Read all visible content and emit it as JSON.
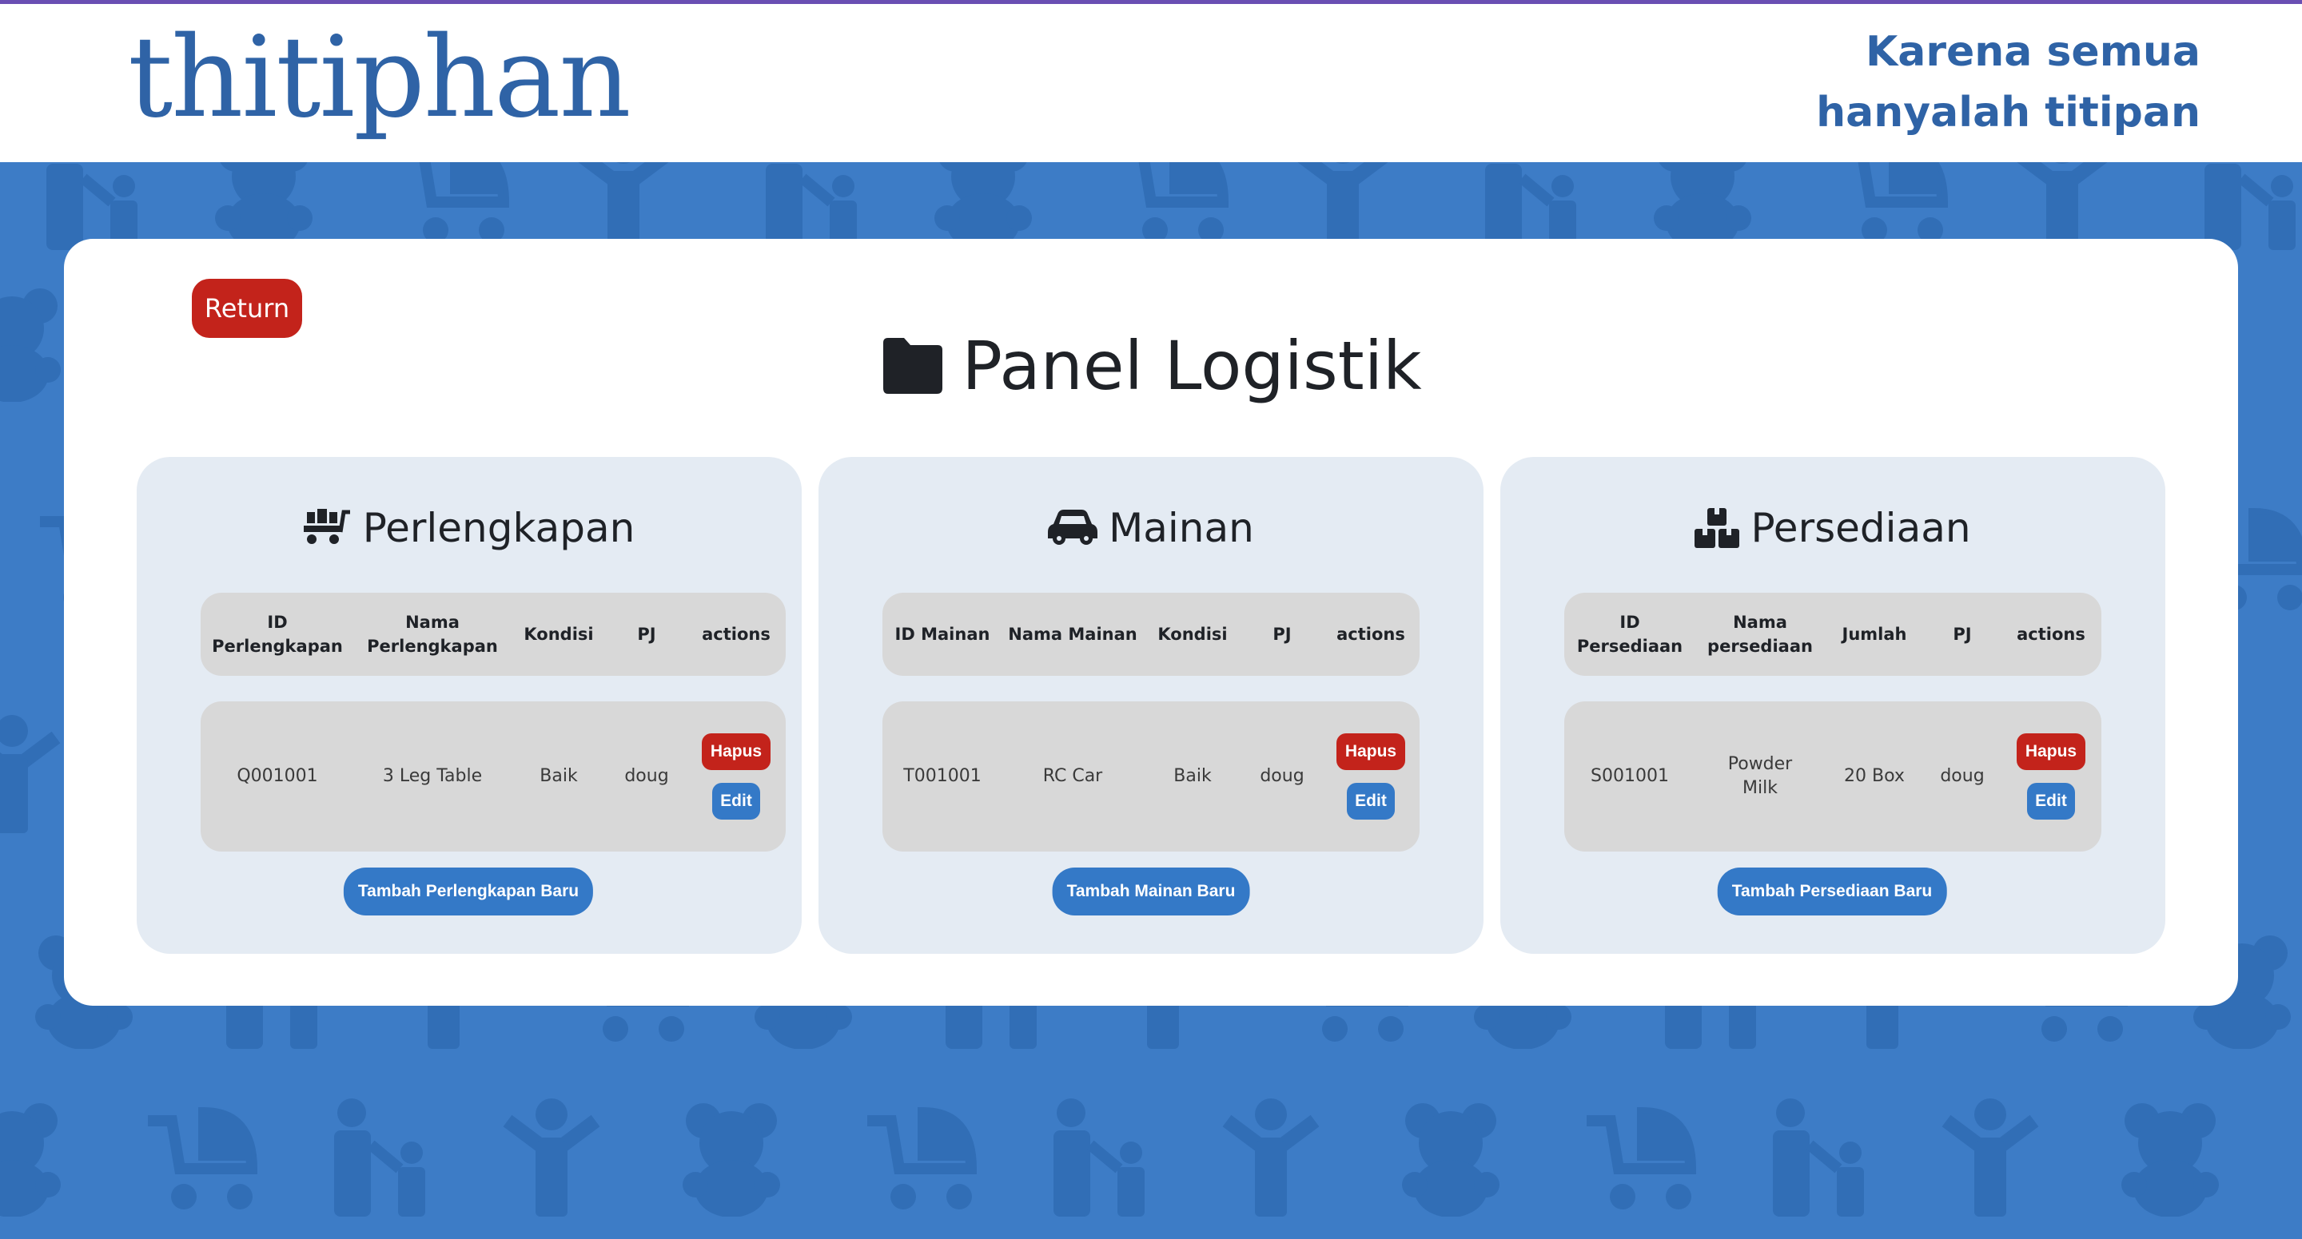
{
  "header": {
    "logo_text": "thitiphan",
    "tagline_line1": "Karena semua",
    "tagline_line2": "hanyalah titipan"
  },
  "main": {
    "return_label": "Return",
    "page_title": "Panel Logistik",
    "title_icon": "folder-icon"
  },
  "colors": {
    "accent_blue": "#3d7cc6",
    "brand_blue": "#2f63a6",
    "danger_red": "#c3231b",
    "button_blue": "#3479c7",
    "card_bg": "#e4ebf3",
    "table_bg": "#d8d8d8"
  },
  "cards": [
    {
      "title": "Perlengkapan",
      "icon": "dolly-cart-icon",
      "headers": [
        "ID Perlengkapan",
        "Nama Perlengkapan",
        "Kondisi",
        "PJ",
        "actions"
      ],
      "rows": [
        {
          "id": "Q001001",
          "name": "3 Leg Table",
          "col3": "Baik",
          "pj": "doug"
        }
      ],
      "delete_label": "Hapus",
      "edit_label": "Edit",
      "add_label": "Tambah Perlengkapan Baru"
    },
    {
      "title": "Mainan",
      "icon": "car-icon",
      "headers": [
        "ID Mainan",
        "Nama Mainan",
        "Kondisi",
        "PJ",
        "actions"
      ],
      "rows": [
        {
          "id": "T001001",
          "name": "RC Car",
          "col3": "Baik",
          "pj": "doug"
        }
      ],
      "delete_label": "Hapus",
      "edit_label": "Edit",
      "add_label": "Tambah Mainan Baru"
    },
    {
      "title": "Persediaan",
      "icon": "boxes-icon",
      "headers": [
        "ID Persediaan",
        "Nama persediaan",
        "Jumlah",
        "PJ",
        "actions"
      ],
      "rows": [
        {
          "id": "S001001",
          "name": "Powder Milk",
          "col3": "20 Box",
          "pj": "doug"
        }
      ],
      "delete_label": "Hapus",
      "edit_label": "Edit",
      "add_label": "Tambah Persediaan Baru"
    }
  ]
}
